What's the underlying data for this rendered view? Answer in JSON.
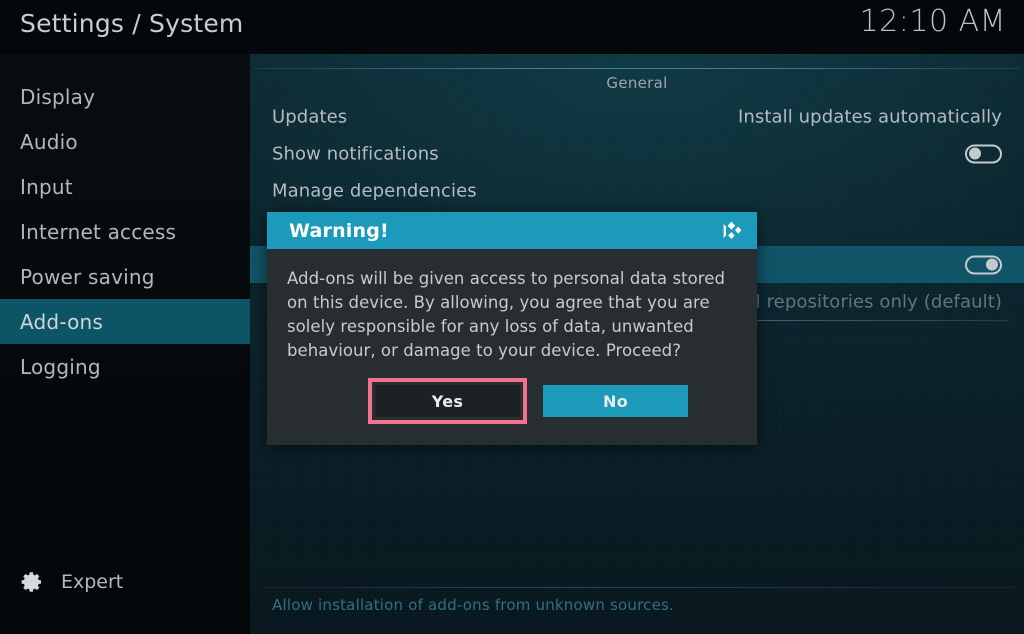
{
  "window": {
    "breadcrumb": "Settings / System",
    "clock": "12:10 AM"
  },
  "colors": {
    "accent_teal": "#1b9ab9",
    "selected_row": "#0d5466",
    "focus_ring_pink": "#f4728f",
    "dialog_body": "#282d31",
    "panel_bg": "#0a2129"
  },
  "sidebar": {
    "items": [
      {
        "label": "Display",
        "selected": false
      },
      {
        "label": "Audio",
        "selected": false
      },
      {
        "label": "Input",
        "selected": false
      },
      {
        "label": "Internet access",
        "selected": false
      },
      {
        "label": "Power saving",
        "selected": false
      },
      {
        "label": "Add-ons",
        "selected": true
      },
      {
        "label": "Logging",
        "selected": false
      }
    ],
    "level": {
      "icon": "gear-icon",
      "label": "Expert"
    }
  },
  "content": {
    "category": "General",
    "rows": [
      {
        "label": "Updates",
        "value": "Install updates automatically",
        "control": "value",
        "highlight": false
      },
      {
        "label": "Show notifications",
        "value": "",
        "control": "toggle-off",
        "highlight": false
      },
      {
        "label": "Manage dependencies",
        "value": "",
        "control": "none",
        "highlight": false
      },
      {
        "label": "",
        "value": "",
        "control": "none",
        "highlight": false
      },
      {
        "label": "",
        "value": "",
        "control": "toggle-on",
        "highlight": true
      },
      {
        "label": "",
        "value": "Official repositories only (default)",
        "control": "value-dim",
        "highlight": false
      }
    ],
    "description": "Allow installation of add-ons from unknown sources."
  },
  "dialog": {
    "title": "Warning!",
    "logo": "kodi-logo",
    "message": "Add-ons will be given access to personal data stored on this device. By allowing, you agree that you are solely responsible for any loss of data, unwanted behaviour, or damage to your device. Proceed?",
    "buttons": {
      "yes": "Yes",
      "no": "No"
    },
    "focused_button": "Yes"
  }
}
